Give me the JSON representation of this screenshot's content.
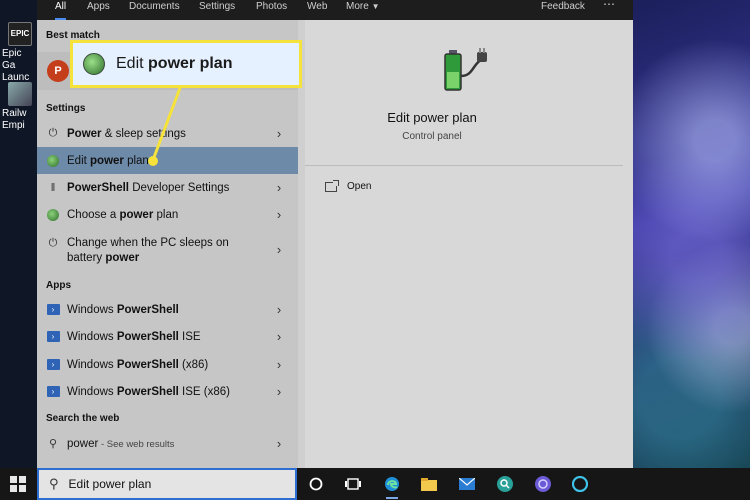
{
  "tabs": [
    {
      "label": "All",
      "active": true
    },
    {
      "label": "Apps"
    },
    {
      "label": "Documents"
    },
    {
      "label": "Settings"
    },
    {
      "label": "Photos"
    },
    {
      "label": "Web"
    },
    {
      "label": "More"
    }
  ],
  "topbar": {
    "feedback_label": "Feedback",
    "more_icon": "ellipsis-icon"
  },
  "desktop_icons": [
    {
      "label": "Epic Ga Launc",
      "tile_text": "EPIC"
    },
    {
      "label": "Railw Empi"
    }
  ],
  "sections": {
    "best_match": "Best match",
    "settings": "Settings",
    "apps": "Apps",
    "search_web": "Search the web"
  },
  "settings_items": [
    {
      "pre": "",
      "bold": "Power",
      "post": " & sleep settings",
      "icon": "power-icon"
    },
    {
      "pre": "Edit ",
      "bold": "power",
      "post": " plan",
      "icon": "leaf-icon",
      "selected": true
    },
    {
      "pre": "",
      "bold": "PowerShell",
      "post": " Developer Settings",
      "icon": "developer-icon"
    },
    {
      "pre": "Choose a ",
      "bold": "power",
      "post": " plan",
      "icon": "leaf-icon"
    },
    {
      "line1": "Change when the PC sleeps on",
      "line2_pre": "battery ",
      "line2_bold": "power",
      "icon": "power-icon"
    }
  ],
  "apps_items": [
    {
      "pre": "Windows ",
      "bold": "PowerShell",
      "post": ""
    },
    {
      "pre": "Windows ",
      "bold": "PowerShell",
      "post": " ISE"
    },
    {
      "pre": "Windows ",
      "bold": "PowerShell",
      "post": " (x86)"
    },
    {
      "pre": "Windows ",
      "bold": "PowerShell",
      "post": " ISE (x86)"
    }
  ],
  "web_item": {
    "query": "power",
    "suffix": " - See web results"
  },
  "callout": {
    "pre": "Edit ",
    "bold": "power plan"
  },
  "detail": {
    "title": "Edit power plan",
    "subtitle": "Control panel",
    "open_label": "Open"
  },
  "search": {
    "value": "Edit power plan"
  },
  "taskbar_icons": [
    "cortana-icon",
    "task-view-icon",
    "edge-icon",
    "file-explorer-icon",
    "mail-icon",
    "search-app-icon",
    "app-icon",
    "alexa-icon"
  ],
  "colors": {
    "highlight": "#f5e23a",
    "selected": "#6d8aa8",
    "accent": "#2c6fd1"
  }
}
